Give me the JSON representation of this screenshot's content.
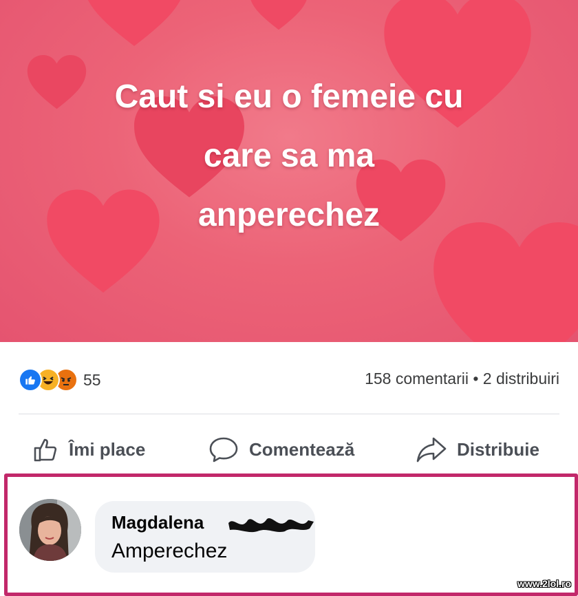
{
  "post": {
    "text_lines": [
      "Caut si eu o femeie cu",
      "care sa ma",
      "anperechez"
    ],
    "background_color": "#ec6377",
    "heart_color": "#f25a72"
  },
  "reactions": {
    "icons": [
      "like-icon",
      "haha-icon",
      "angry-icon"
    ],
    "count": "55"
  },
  "stats": {
    "text": "158 comentarii • 2 distribuiri"
  },
  "actions": {
    "like_label": "Îmi place",
    "comment_label": "Comentează",
    "share_label": "Distribuie"
  },
  "comment": {
    "author": "Magdalena",
    "text": "Amperechez",
    "highlight_color": "#c2286a"
  },
  "watermark": "www.2lol.ro"
}
